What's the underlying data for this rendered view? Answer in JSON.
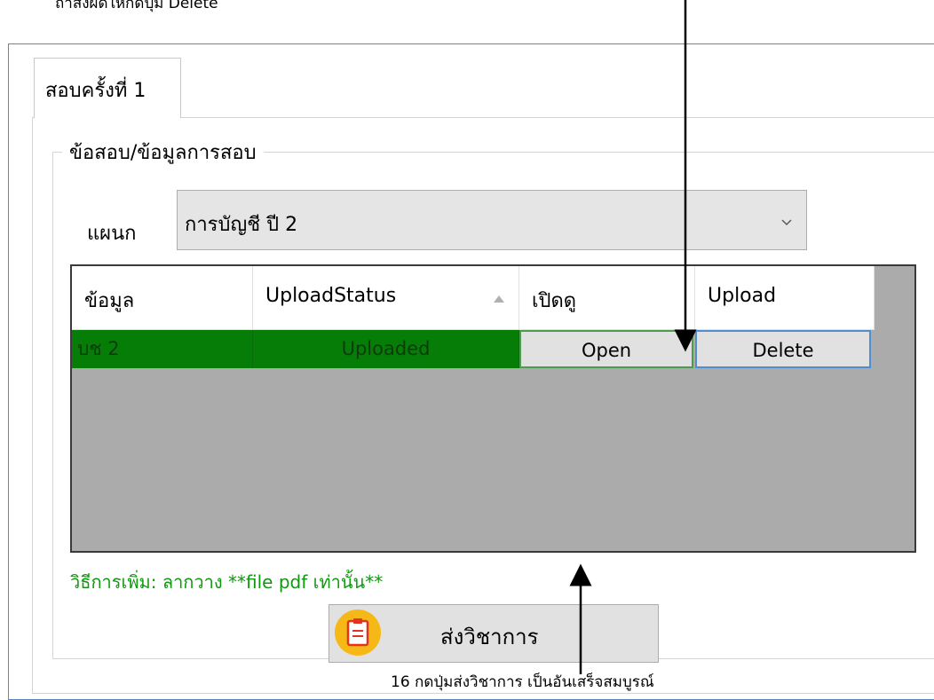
{
  "captions": {
    "top_note": "ถ้าส่งผิดให้กดปุ่ม Delete",
    "bottom_note": "16 กดปุ่มส่งวิชาการ เป็นอันเสร็จสมบูรณ์"
  },
  "tab": {
    "label": "สอบครั้งที่ 1"
  },
  "group": {
    "legend": "ข้อสอบ/ข้อมูลการสอบ"
  },
  "department": {
    "label": "แผนก",
    "selected": "การบัญชี ปี 2"
  },
  "grid": {
    "columns": [
      "ข้อมูล",
      "UploadStatus",
      "เปิดดู",
      "Upload"
    ],
    "sort_column": "UploadStatus",
    "rows": [
      {
        "data": "บช 2",
        "status": "Uploaded",
        "open": "Open",
        "upload": "Delete"
      }
    ]
  },
  "hint": "วิธีการเพิ่ม: ลากวาง **file pdf เท่านั้น**",
  "send_button": {
    "label": "ส่งวิชาการ",
    "icon": "clipboard-icon"
  },
  "colors": {
    "row_green": "#067d06",
    "grid_bg": "#ababab",
    "hint_green": "#109810",
    "icon_yellow": "#f6b817",
    "window_border": "#5b87c7"
  }
}
